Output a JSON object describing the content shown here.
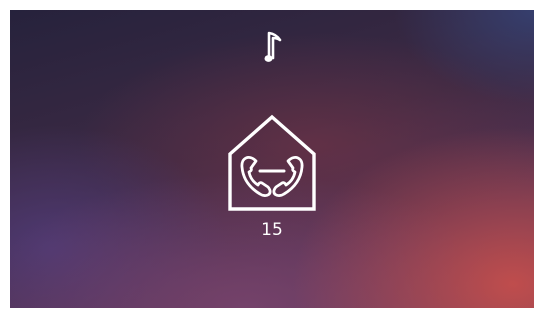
{
  "status": {
    "icon": "music-note-icon"
  },
  "call": {
    "icon": "intercom-house-handsets-icon",
    "counter": "15"
  }
}
